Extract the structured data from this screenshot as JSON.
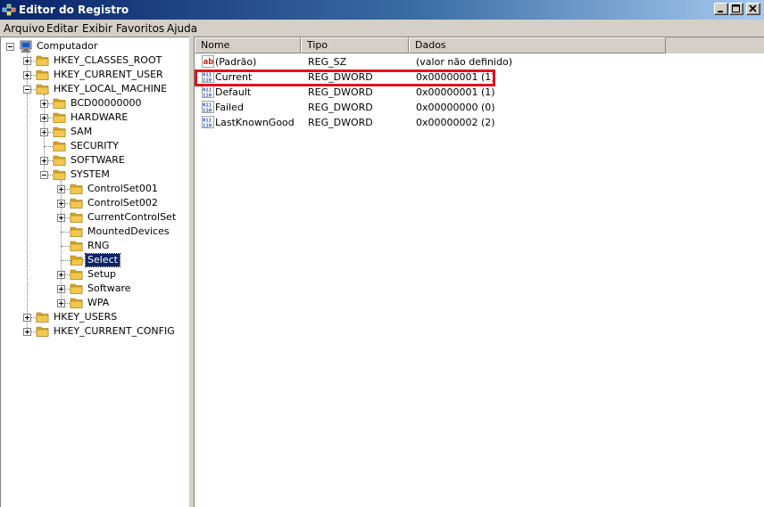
{
  "window": {
    "title": "Editor do Registro"
  },
  "menu": [
    "Arquivo",
    "Editar",
    "Exibir",
    "Favoritos",
    "Ajuda"
  ],
  "tree": [
    {
      "label": "Computador",
      "expander": "minus",
      "icon": "computer-icon",
      "level": 0
    },
    {
      "label": "HKEY_CLASSES_ROOT",
      "expander": "plus",
      "icon": "folder-icon",
      "level": 1
    },
    {
      "label": "HKEY_CURRENT_USER",
      "expander": "plus",
      "icon": "folder-icon",
      "level": 1
    },
    {
      "label": "HKEY_LOCAL_MACHINE",
      "expander": "minus",
      "icon": "folder-icon",
      "level": 1
    },
    {
      "label": "BCD00000000",
      "expander": "plus",
      "icon": "folder-icon",
      "level": 2
    },
    {
      "label": "HARDWARE",
      "expander": "plus",
      "icon": "folder-icon",
      "level": 2
    },
    {
      "label": "SAM",
      "expander": "plus",
      "icon": "folder-icon",
      "level": 2
    },
    {
      "label": "SECURITY",
      "expander": "none",
      "icon": "folder-icon",
      "level": 2
    },
    {
      "label": "SOFTWARE",
      "expander": "plus",
      "icon": "folder-icon",
      "level": 2
    },
    {
      "label": "SYSTEM",
      "expander": "minus",
      "icon": "folder-icon",
      "level": 2
    },
    {
      "label": "ControlSet001",
      "expander": "plus",
      "icon": "folder-icon",
      "level": 3
    },
    {
      "label": "ControlSet002",
      "expander": "plus",
      "icon": "folder-icon",
      "level": 3
    },
    {
      "label": "CurrentControlSet",
      "expander": "plus",
      "icon": "folder-icon",
      "level": 3
    },
    {
      "label": "MountedDevices",
      "expander": "none",
      "icon": "folder-icon",
      "level": 3
    },
    {
      "label": "RNG",
      "expander": "none",
      "icon": "folder-icon",
      "level": 3
    },
    {
      "label": "Select",
      "expander": "none",
      "icon": "folder-open-icon",
      "level": 3,
      "selected": true
    },
    {
      "label": "Setup",
      "expander": "plus",
      "icon": "folder-icon",
      "level": 3
    },
    {
      "label": "Software",
      "expander": "plus",
      "icon": "folder-icon",
      "level": 3
    },
    {
      "label": "WPA",
      "expander": "plus",
      "icon": "folder-icon",
      "level": 3
    },
    {
      "label": "HKEY_USERS",
      "expander": "plus",
      "icon": "folder-icon",
      "level": 1
    },
    {
      "label": "HKEY_CURRENT_CONFIG",
      "expander": "plus",
      "icon": "folder-icon",
      "level": 1
    }
  ],
  "list": {
    "columns": [
      "Nome",
      "Tipo",
      "Dados"
    ],
    "rows": [
      {
        "name": "(Padrão)",
        "type": "REG_SZ",
        "data": "(valor não definido)",
        "icon": "string-value-icon"
      },
      {
        "name": "Current",
        "type": "REG_DWORD",
        "data": "0x00000001 (1)",
        "icon": "dword-value-icon",
        "highlighted": true
      },
      {
        "name": "Default",
        "type": "REG_DWORD",
        "data": "0x00000001 (1)",
        "icon": "dword-value-icon"
      },
      {
        "name": "Failed",
        "type": "REG_DWORD",
        "data": "0x00000000 (0)",
        "icon": "dword-value-icon"
      },
      {
        "name": "LastKnownGood",
        "type": "REG_DWORD",
        "data": "0x00000002 (2)",
        "icon": "dword-value-icon"
      }
    ]
  },
  "colors": {
    "title_gradient_start": "#0a246a",
    "title_gradient_end": "#a6caf0",
    "selection": "#0a246a",
    "highlight_box": "#e0131d",
    "folder": "#f2c94c"
  }
}
